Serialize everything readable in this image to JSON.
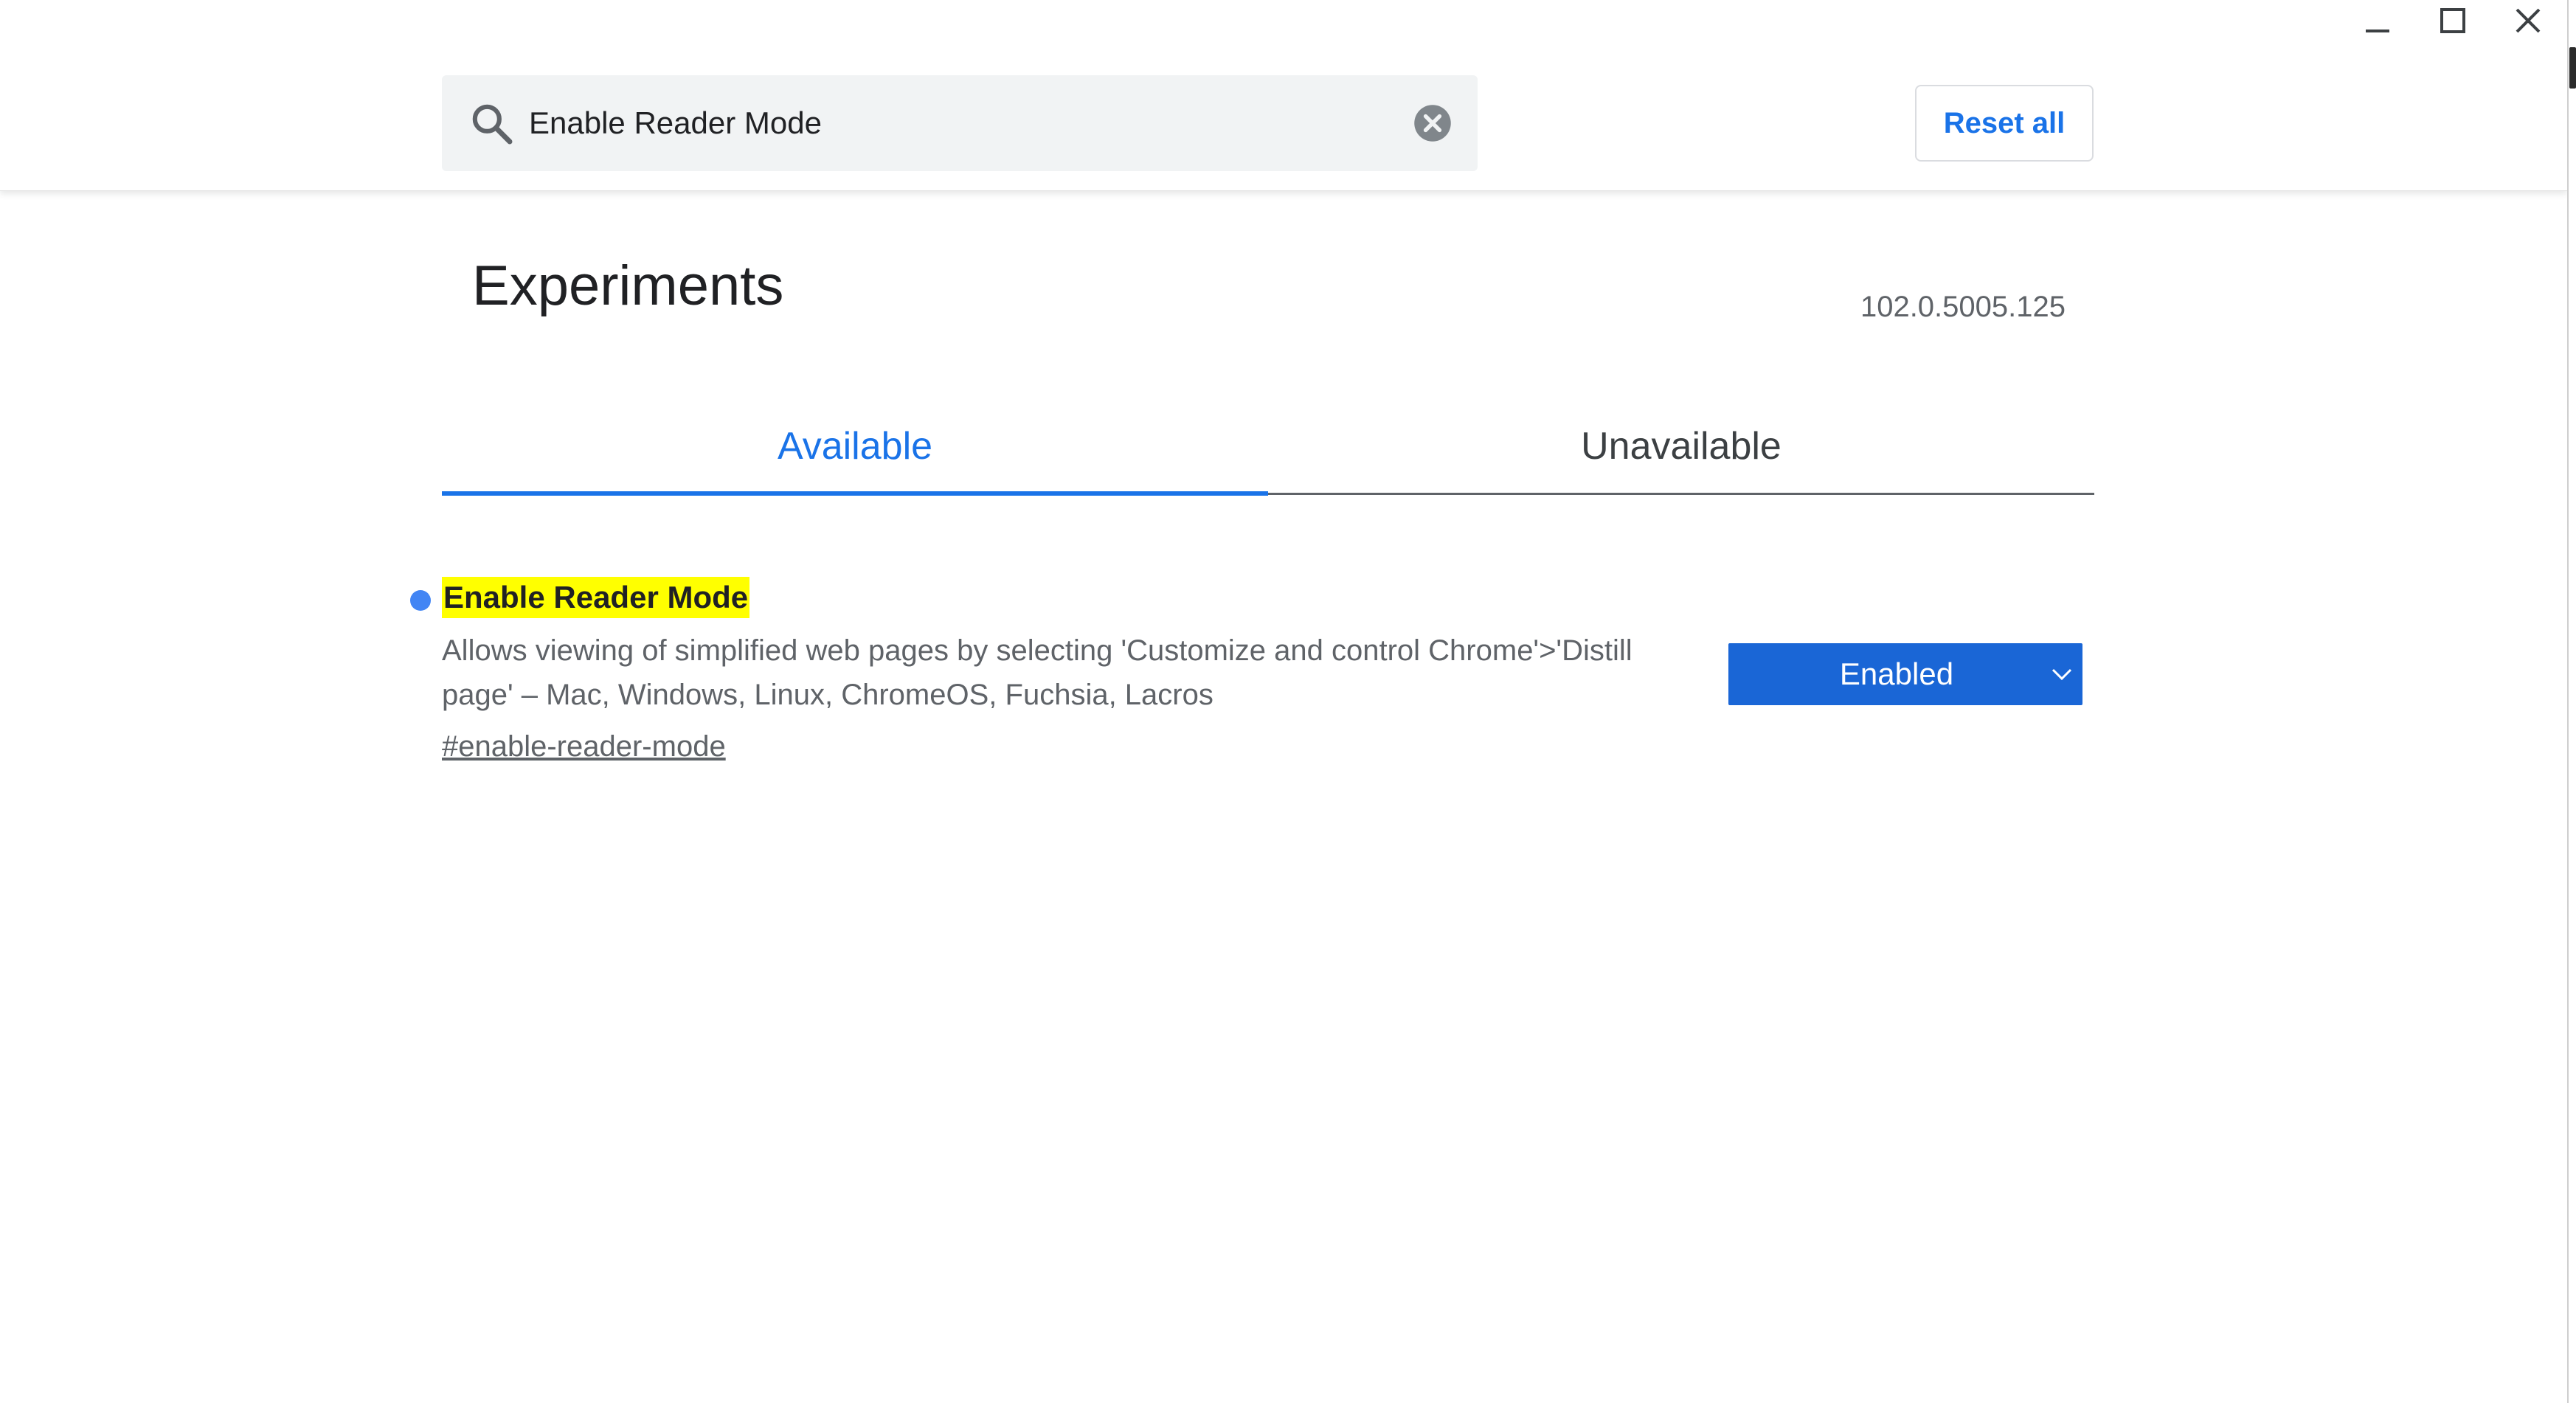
{
  "window": {
    "minimize_icon": "minimize-icon",
    "maximize_icon": "maximize-icon",
    "close_icon": "close-icon"
  },
  "header": {
    "search": {
      "value": "Enable Reader Mode",
      "icon": "search-icon",
      "clear_icon": "clear-circle-icon"
    },
    "reset_label": "Reset all"
  },
  "page": {
    "title": "Experiments",
    "version": "102.0.5005.125"
  },
  "tabs": [
    {
      "label": "Available",
      "selected": true
    },
    {
      "label": "Unavailable",
      "selected": false
    }
  ],
  "experiments": [
    {
      "title": "Enable Reader Mode",
      "description": "Allows viewing of simplified web pages by selecting 'Customize and control Chrome'>'Distill page' – Mac, Windows, Linux, ChromeOS, Fuchsia, Lacros",
      "link": "#enable-reader-mode",
      "state": "Enabled",
      "modified": true
    }
  ],
  "colors": {
    "accent": "#1a73e8",
    "select_bg": "#1a66d6",
    "highlight": "#ffff00",
    "modified_dot": "#4285f4"
  }
}
